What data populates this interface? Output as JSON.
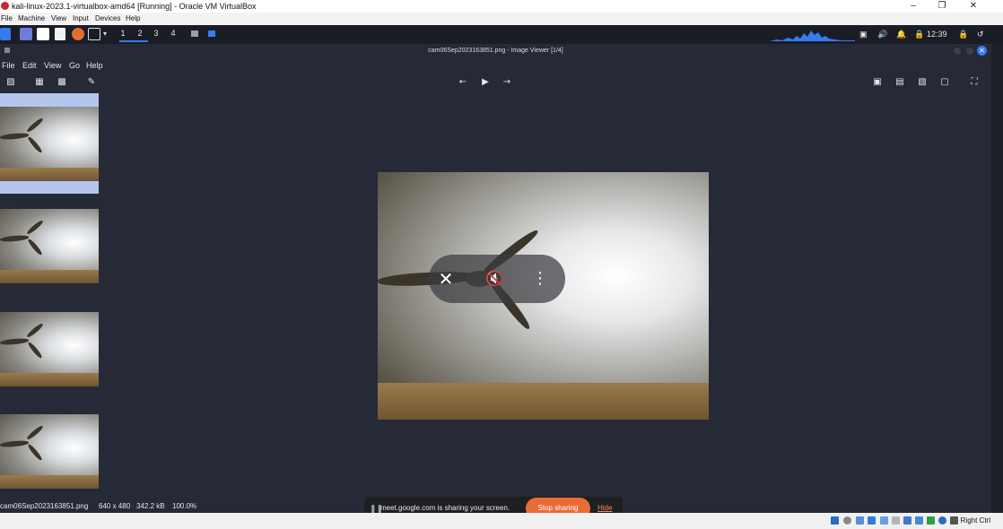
{
  "vbox": {
    "title": "kali-linux-2023.1-virtualbox-amd64 [Running] - Oracle VM VirtualBox",
    "menu": [
      "File",
      "Machine",
      "View",
      "Input",
      "Devices",
      "Help"
    ],
    "host_key": "Right Ctrl"
  },
  "panel": {
    "workspaces": [
      "1",
      "2",
      "3",
      "4"
    ],
    "clock": "12:39"
  },
  "viewer": {
    "title": "cam06Sep2023163851.png - Image Viewer [1/4]",
    "menu": [
      "File",
      "Edit",
      "View",
      "Go",
      "Help"
    ]
  },
  "status": {
    "filename": "cam06Sep2023163851.png",
    "dimensions": "640 x 480",
    "size": "342.2 kB",
    "zoom": "100.0%"
  },
  "meet": {
    "message": "meet.google.com is sharing your screen.",
    "stop_label": "Stop sharing",
    "hide_label": "Hide"
  },
  "colors": {
    "accent": "#367bf0",
    "stop": "#ea6c35",
    "selection": "#b4c6ee"
  }
}
